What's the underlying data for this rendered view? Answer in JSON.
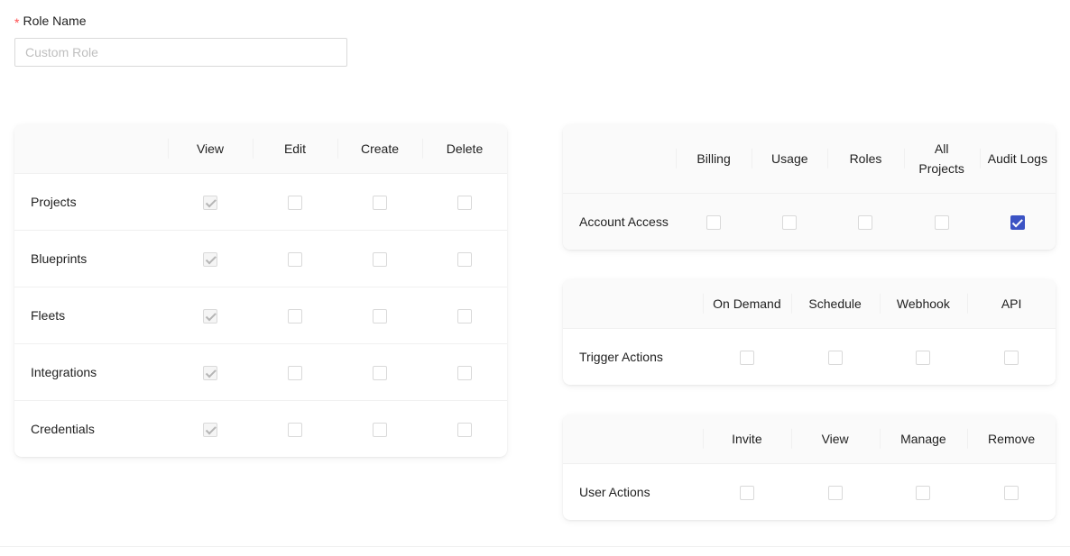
{
  "form": {
    "role_name_label": "Role Name",
    "required_marker": "*",
    "role_name_value": "",
    "role_name_placeholder": "Custom Role"
  },
  "colors": {
    "accent_checked": "#3b53c4",
    "required_star": "#ff4d4f",
    "header_bg": "#fafafa",
    "border": "#f0f0f0",
    "checkbox_border": "#d9d9d9",
    "disabled_fill": "#f5f5f5"
  },
  "tables": {
    "resources": {
      "name_header": "",
      "columns": [
        "View",
        "Edit",
        "Create",
        "Delete"
      ],
      "rows": [
        {
          "label": "Projects",
          "cells": [
            {
              "checked": true,
              "disabled": true
            },
            {
              "checked": false,
              "disabled": false
            },
            {
              "checked": false,
              "disabled": false
            },
            {
              "checked": false,
              "disabled": false
            }
          ]
        },
        {
          "label": "Blueprints",
          "cells": [
            {
              "checked": true,
              "disabled": true
            },
            {
              "checked": false,
              "disabled": false
            },
            {
              "checked": false,
              "disabled": false
            },
            {
              "checked": false,
              "disabled": false
            }
          ]
        },
        {
          "label": "Fleets",
          "cells": [
            {
              "checked": true,
              "disabled": true
            },
            {
              "checked": false,
              "disabled": false
            },
            {
              "checked": false,
              "disabled": false
            },
            {
              "checked": false,
              "disabled": false
            }
          ]
        },
        {
          "label": "Integrations",
          "cells": [
            {
              "checked": true,
              "disabled": true
            },
            {
              "checked": false,
              "disabled": false
            },
            {
              "checked": false,
              "disabled": false
            },
            {
              "checked": false,
              "disabled": false
            }
          ]
        },
        {
          "label": "Credentials",
          "cells": [
            {
              "checked": true,
              "disabled": true
            },
            {
              "checked": false,
              "disabled": false
            },
            {
              "checked": false,
              "disabled": false
            },
            {
              "checked": false,
              "disabled": false
            }
          ]
        }
      ]
    },
    "account": {
      "name_header": "",
      "columns": [
        "Billing",
        "Usage",
        "Roles",
        "All Projects",
        "Audit Logs"
      ],
      "rows": [
        {
          "label": "Account Access",
          "hover": true,
          "cells": [
            {
              "checked": false,
              "disabled": false
            },
            {
              "checked": false,
              "disabled": false
            },
            {
              "checked": false,
              "disabled": false
            },
            {
              "checked": false,
              "disabled": false
            },
            {
              "checked": true,
              "disabled": false
            }
          ]
        }
      ]
    },
    "trigger": {
      "name_header": "",
      "columns": [
        "On Demand",
        "Schedule",
        "Webhook",
        "API"
      ],
      "rows": [
        {
          "label": "Trigger Actions",
          "hover": false,
          "cells": [
            {
              "checked": false,
              "disabled": false
            },
            {
              "checked": false,
              "disabled": false
            },
            {
              "checked": false,
              "disabled": false
            },
            {
              "checked": false,
              "disabled": false
            }
          ]
        }
      ]
    },
    "user": {
      "name_header": "",
      "columns": [
        "Invite",
        "View",
        "Manage",
        "Remove"
      ],
      "rows": [
        {
          "label": "User Actions",
          "hover": false,
          "cells": [
            {
              "checked": false,
              "disabled": false
            },
            {
              "checked": false,
              "disabled": false
            },
            {
              "checked": false,
              "disabled": false
            },
            {
              "checked": false,
              "disabled": false
            }
          ]
        }
      ]
    }
  }
}
